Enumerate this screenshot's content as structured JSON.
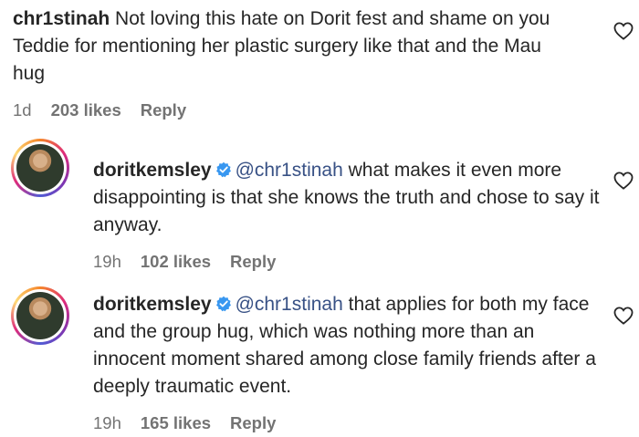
{
  "comments": [
    {
      "username": "chr1stinah",
      "text": "Not loving this hate on Dorit fest and shame on you Teddie for mentioning her plastic surgery like that and the Mau hug",
      "time": "1d",
      "likes": "203 likes",
      "reply": "Reply"
    },
    {
      "username": "doritkemsley",
      "mention": "@chr1stinah",
      "text": "what makes it even more disappointing is that she knows the truth and chose to say it anyway.",
      "time": "19h",
      "likes": "102 likes",
      "reply": "Reply"
    },
    {
      "username": "doritkemsley",
      "mention": "@chr1stinah",
      "text": "that applies for both my face and the group hug, which was nothing more than an innocent moment shared among close family friends after a deeply traumatic event.",
      "time": "19h",
      "likes": "165 likes",
      "reply": "Reply"
    }
  ],
  "colors": {
    "mention": "#385185",
    "verified": "#3897f0",
    "meta": "#737373"
  },
  "icons": [
    "heart-icon",
    "verified-badge-icon",
    "avatar"
  ]
}
